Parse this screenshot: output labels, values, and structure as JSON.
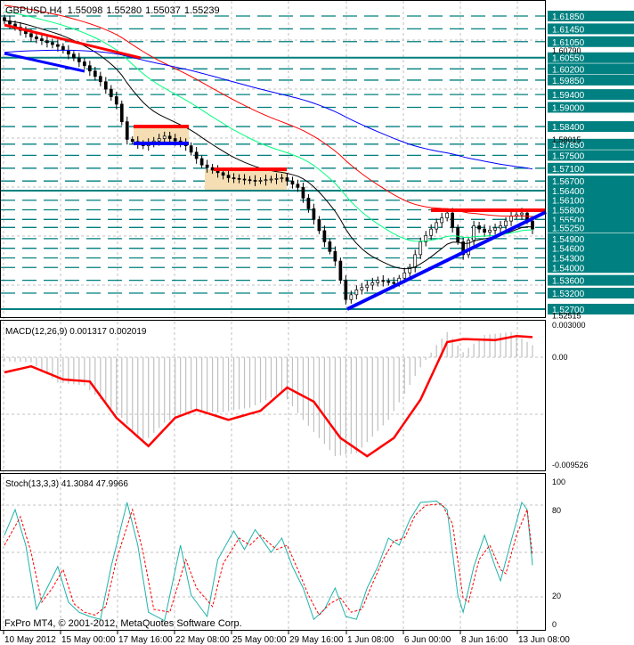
{
  "header": {
    "symbol": "GBPUSD,H4",
    "open": "1.55098",
    "high": "1.55280",
    "low": "1.55037",
    "close": "1.55239"
  },
  "footer": {
    "copyright": "FxPro MT4, © 2001-2012, MetaQuotes Software Corp."
  },
  "chart_data": [
    {
      "type": "candlestick",
      "title": "GBPUSD,H4",
      "ylim": [
        1.52515,
        1.62
      ],
      "price_labels": [
        "1.61850",
        "1.61450",
        "1.61050",
        "1.60550",
        "1.60200",
        "1.59850",
        "1.59400",
        "1.59000",
        "1.58400",
        "1.57850",
        "1.57500",
        "1.57100",
        "1.56700",
        "1.56400",
        "1.56100",
        "1.55800",
        "1.55500",
        "1.55250",
        "1.54900",
        "1.54600",
        "1.54300",
        "1.54000",
        "1.53600",
        "1.53200",
        "1.52700"
      ],
      "scale_labels": [
        "1.60790",
        "1.58015",
        "1.52515"
      ],
      "solid_levels": [
        1.6055,
        1.564,
        1.527
      ],
      "x_labels": [
        "10 May 2012",
        "15 May 00:00",
        "17 May 16:00",
        "22 May 08:00",
        "25 May 00:00",
        "29 May 16:00",
        "1 Jun 08:00",
        "6 Jun 00:00",
        "8 Jun 16:00",
        "13 Jun 08:00"
      ],
      "close_keypoints": [
        [
          0,
          1.617
        ],
        [
          5,
          1.612
        ],
        [
          10,
          1.609
        ],
        [
          15,
          1.603
        ],
        [
          18,
          1.598
        ],
        [
          21,
          1.591
        ],
        [
          23,
          1.58
        ],
        [
          26,
          1.578
        ],
        [
          30,
          1.581
        ],
        [
          34,
          1.578
        ],
        [
          37,
          1.572
        ],
        [
          42,
          1.568
        ],
        [
          47,
          1.567
        ],
        [
          52,
          1.568
        ],
        [
          55,
          1.565
        ],
        [
          58,
          1.555
        ],
        [
          60,
          1.548
        ],
        [
          62,
          1.542
        ],
        [
          64,
          1.53
        ],
        [
          66,
          1.533
        ],
        [
          70,
          1.536
        ],
        [
          73,
          1.535
        ],
        [
          76,
          1.54
        ],
        [
          78,
          1.548
        ],
        [
          81,
          1.554
        ],
        [
          83,
          1.557
        ],
        [
          85,
          1.548
        ],
        [
          86,
          1.544
        ],
        [
          88,
          1.553
        ],
        [
          90,
          1.551
        ],
        [
          93,
          1.553
        ],
        [
          95,
          1.556
        ],
        [
          97,
          1.557
        ],
        [
          99,
          1.552
        ]
      ],
      "moving_averages": [
        {
          "color": "#000000",
          "seed": 1.617,
          "alpha": 0.12
        },
        {
          "color": "#00ff7f",
          "seed": 1.62,
          "alpha": 0.06
        },
        {
          "color": "#ff0000",
          "seed": 1.622,
          "alpha": 0.035
        },
        {
          "color": "#0000ff",
          "seed": 1.607,
          "alpha": 0.015
        }
      ]
    },
    {
      "type": "line+histogram",
      "title": "MACD(12,26,9) 0.001317 0.002019",
      "ylim": [
        -0.00952,
        0.003
      ],
      "y_labels": [
        "0.003000",
        "0.00",
        "-0.009526"
      ],
      "signal_keypoints": [
        [
          0,
          -0.0015
        ],
        [
          5,
          -0.0009
        ],
        [
          11,
          -0.0022
        ],
        [
          16,
          -0.0024
        ],
        [
          21,
          -0.006
        ],
        [
          27,
          -0.0088
        ],
        [
          32,
          -0.006
        ],
        [
          36,
          -0.0052
        ],
        [
          42,
          -0.0062
        ],
        [
          48,
          -0.0053
        ],
        [
          53,
          -0.003
        ],
        [
          58,
          -0.0044
        ],
        [
          63,
          -0.008
        ],
        [
          68,
          -0.0098
        ],
        [
          73,
          -0.008
        ],
        [
          78,
          -0.0042
        ],
        [
          83,
          0.0015
        ],
        [
          86,
          0.0018
        ],
        [
          92,
          0.0017
        ],
        [
          96,
          0.0021
        ],
        [
          99,
          0.002
        ]
      ],
      "histogram_keypoints": [
        [
          0,
          -0.0004
        ],
        [
          5,
          -0.0005
        ],
        [
          10,
          -0.0025
        ],
        [
          15,
          -0.0028
        ],
        [
          22,
          -0.006
        ],
        [
          26,
          -0.0085
        ],
        [
          30,
          -0.0065
        ],
        [
          35,
          -0.0052
        ],
        [
          40,
          -0.0055
        ],
        [
          46,
          -0.005
        ],
        [
          52,
          -0.0035
        ],
        [
          56,
          -0.0062
        ],
        [
          62,
          -0.0098
        ],
        [
          66,
          -0.0095
        ],
        [
          72,
          -0.0062
        ],
        [
          78,
          -0.001
        ],
        [
          81,
          0.0012
        ],
        [
          83,
          0.0025
        ],
        [
          86,
          0.0005
        ],
        [
          90,
          0.0022
        ],
        [
          95,
          0.0025
        ],
        [
          99,
          0.0012
        ]
      ]
    },
    {
      "type": "line",
      "title": "Stoch(13,3,3) 41.3084 47.9966",
      "ylim": [
        0,
        100
      ],
      "y_labels": [
        "100",
        "80",
        "20",
        "0"
      ],
      "main_keypoints": [
        [
          0,
          62
        ],
        [
          2,
          80
        ],
        [
          4,
          55
        ],
        [
          6,
          10
        ],
        [
          8,
          25
        ],
        [
          10,
          40
        ],
        [
          12,
          15
        ],
        [
          14,
          8
        ],
        [
          16,
          5
        ],
        [
          18,
          3
        ],
        [
          20,
          40
        ],
        [
          23,
          85
        ],
        [
          25,
          55
        ],
        [
          27,
          8
        ],
        [
          30,
          2
        ],
        [
          33,
          55
        ],
        [
          35,
          20
        ],
        [
          38,
          5
        ],
        [
          40,
          45
        ],
        [
          43,
          65
        ],
        [
          45,
          52
        ],
        [
          47,
          66
        ],
        [
          50,
          50
        ],
        [
          52,
          60
        ],
        [
          54,
          40
        ],
        [
          56,
          25
        ],
        [
          58,
          3
        ],
        [
          60,
          10
        ],
        [
          62,
          25
        ],
        [
          64,
          5
        ],
        [
          66,
          3
        ],
        [
          68,
          25
        ],
        [
          70,
          40
        ],
        [
          72,
          60
        ],
        [
          74,
          55
        ],
        [
          76,
          73
        ],
        [
          78,
          85
        ],
        [
          81,
          86
        ],
        [
          83,
          80
        ],
        [
          85,
          20
        ],
        [
          86,
          8
        ],
        [
          88,
          40
        ],
        [
          90,
          62
        ],
        [
          92,
          40
        ],
        [
          93,
          30
        ],
        [
          95,
          58
        ],
        [
          97,
          85
        ],
        [
          98,
          80
        ],
        [
          99,
          41
        ]
      ],
      "signal_keypoints": [
        [
          0,
          55
        ],
        [
          3,
          75
        ],
        [
          5,
          50
        ],
        [
          7,
          15
        ],
        [
          9,
          25
        ],
        [
          11,
          38
        ],
        [
          13,
          14
        ],
        [
          15,
          8
        ],
        [
          17,
          6
        ],
        [
          19,
          12
        ],
        [
          21,
          45
        ],
        [
          24,
          80
        ],
        [
          26,
          50
        ],
        [
          28,
          10
        ],
        [
          31,
          8
        ],
        [
          34,
          45
        ],
        [
          36,
          25
        ],
        [
          39,
          12
        ],
        [
          41,
          42
        ],
        [
          44,
          60
        ],
        [
          46,
          55
        ],
        [
          48,
          62
        ],
        [
          51,
          52
        ],
        [
          53,
          55
        ],
        [
          55,
          38
        ],
        [
          57,
          20
        ],
        [
          59,
          6
        ],
        [
          61,
          14
        ],
        [
          63,
          18
        ],
        [
          65,
          8
        ],
        [
          67,
          10
        ],
        [
          69,
          28
        ],
        [
          71,
          45
        ],
        [
          73,
          58
        ],
        [
          75,
          60
        ],
        [
          77,
          76
        ],
        [
          79,
          83
        ],
        [
          82,
          84
        ],
        [
          84,
          70
        ],
        [
          86,
          18
        ],
        [
          87,
          15
        ],
        [
          89,
          45
        ],
        [
          91,
          55
        ],
        [
          93,
          38
        ],
        [
          94,
          35
        ],
        [
          96,
          62
        ],
        [
          98,
          80
        ],
        [
          99,
          48
        ]
      ]
    }
  ]
}
